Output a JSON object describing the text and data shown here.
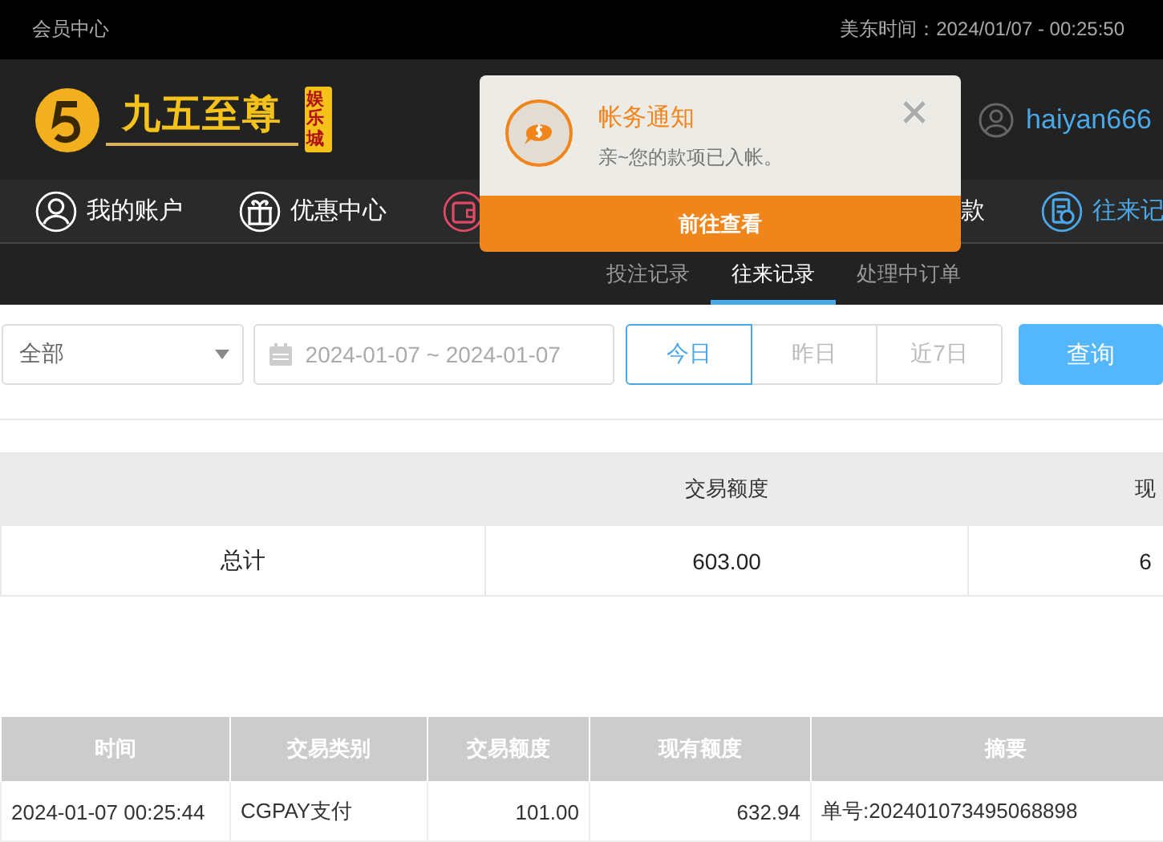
{
  "top_bar": {
    "title": "会员中心",
    "time": "美东时间：2024/01/07 - 00:25:50"
  },
  "header": {
    "logo_text": "九五至尊",
    "logo_badge": "娱乐城",
    "username": "haiyan666"
  },
  "nav": [
    {
      "label": "我的账户",
      "kind": "user",
      "selected": false
    },
    {
      "label": "优惠中心",
      "kind": "gift",
      "selected": false
    },
    {
      "kind": "wallet",
      "selected": false
    },
    {
      "label": "款",
      "kind": "text",
      "selected": false
    },
    {
      "label": "往来记",
      "kind": "records",
      "selected": true
    }
  ],
  "sub_tabs": [
    {
      "label": "投注记录",
      "selected": false
    },
    {
      "label": "往来记录",
      "selected": true
    },
    {
      "label": "处理中订单",
      "selected": false
    }
  ],
  "filters": {
    "type_select": "全部",
    "date_range": "2024-01-07 ~ 2024-01-07",
    "quick_ranges": [
      {
        "label": "今日",
        "selected": true
      },
      {
        "label": "昨日",
        "selected": false
      },
      {
        "label": "近7日",
        "selected": false
      }
    ],
    "query_button": "查询"
  },
  "summary_table": {
    "columns": [
      "",
      "交易额度",
      "现"
    ],
    "rows": [
      [
        "总计",
        "603.00",
        "6"
      ]
    ]
  },
  "detail_table": {
    "columns": [
      "时间",
      "交易类别",
      "交易额度",
      "现有额度",
      "摘要"
    ],
    "rows": [
      [
        "2024-01-07 00:25:44",
        "CGPAY支付",
        "101.00",
        "632.94",
        "单号:202401073495068898"
      ]
    ]
  },
  "notification": {
    "title": "帐务通知",
    "message": "亲~您的款项已入帐。",
    "action": "前往查看"
  }
}
